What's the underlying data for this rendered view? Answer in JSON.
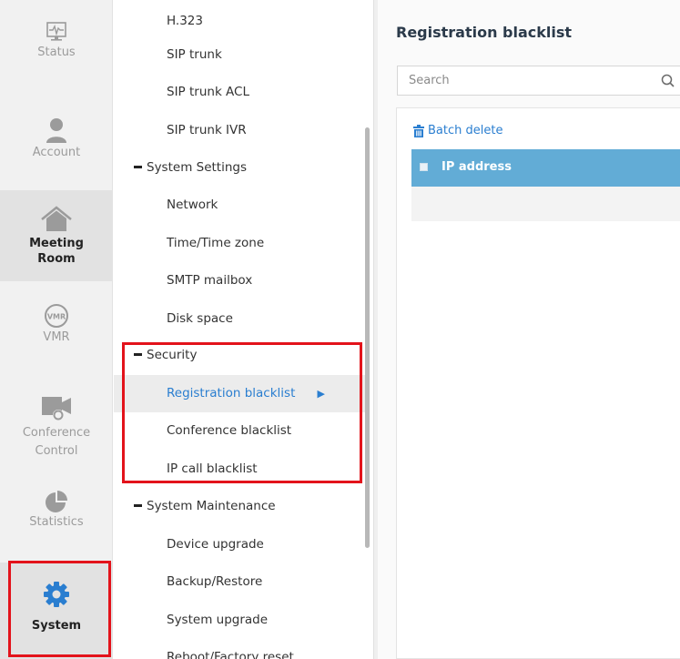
{
  "rail": {
    "status": "Status",
    "account": "Account",
    "meeting_room": "Meeting Room",
    "vmr": "VMR",
    "conference_control": "Conference Control",
    "statistics": "Statistics",
    "system": "System"
  },
  "menu": {
    "h323": "H.323",
    "sip_trunk": "SIP trunk",
    "sip_trunk_acl": "SIP trunk ACL",
    "sip_trunk_ivr": "SIP trunk IVR",
    "system_settings": "System Settings",
    "network": "Network",
    "time_zone": "Time/Time zone",
    "smtp": "SMTP mailbox",
    "disk": "Disk space",
    "security": "Security",
    "registration_blacklist": "Registration blacklist",
    "conference_blacklist": "Conference blacklist",
    "ip_call_blacklist": "IP call blacklist",
    "system_maintenance": "System Maintenance",
    "device_upgrade": "Device upgrade",
    "backup_restore": "Backup/Restore",
    "system_upgrade": "System upgrade",
    "reboot_reset": "Reboot/Factory reset"
  },
  "main": {
    "title": "Registration blacklist",
    "search_placeholder": "Search",
    "batch_delete": "Batch delete",
    "col_ip": "IP address"
  },
  "colors": {
    "accent": "#2a7ed0",
    "table_header": "#62acd6",
    "highlight": "#e3131b"
  }
}
